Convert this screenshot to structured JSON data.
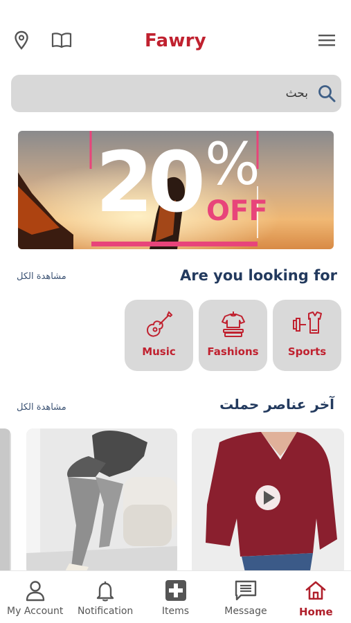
{
  "header": {
    "brand": "Fawry",
    "left_icons": [
      "location-pin-icon",
      "book-icon"
    ],
    "menu_icon": "hamburger-menu-icon"
  },
  "search": {
    "placeholder": "بحث",
    "icon": "search-icon"
  },
  "banner": {
    "discount_number": "20",
    "percent_symbol": "%",
    "off_text": "OFF",
    "accent_color": "#e8447a"
  },
  "categories_section": {
    "title": "Are you looking for",
    "see_all": "مشاهدة الكل",
    "items": [
      {
        "label": "Sports",
        "icon": "dumbbell-shirt-icon"
      },
      {
        "label": "Fashions",
        "icon": "clothes-icon"
      },
      {
        "label": "Music",
        "icon": "guitar-icon"
      }
    ]
  },
  "recent_section": {
    "title": "آخر عناصر حملت",
    "see_all": "مشاهدة الكل",
    "products": [
      {
        "name": "red-blouse",
        "has_video": true
      },
      {
        "name": "gray-outfit",
        "has_video": false
      }
    ]
  },
  "bottom_nav": {
    "items": [
      {
        "label": "My Account",
        "icon": "user-icon"
      },
      {
        "label": "Notification",
        "icon": "bell-icon"
      },
      {
        "label": "Items",
        "icon": "plus-square-icon"
      },
      {
        "label": "Message",
        "icon": "message-icon"
      },
      {
        "label": "Home",
        "icon": "home-icon",
        "active": true
      }
    ]
  },
  "colors": {
    "brand_red": "#c0212f",
    "title_navy": "#233a5e",
    "card_gray": "#d9d9d9"
  }
}
